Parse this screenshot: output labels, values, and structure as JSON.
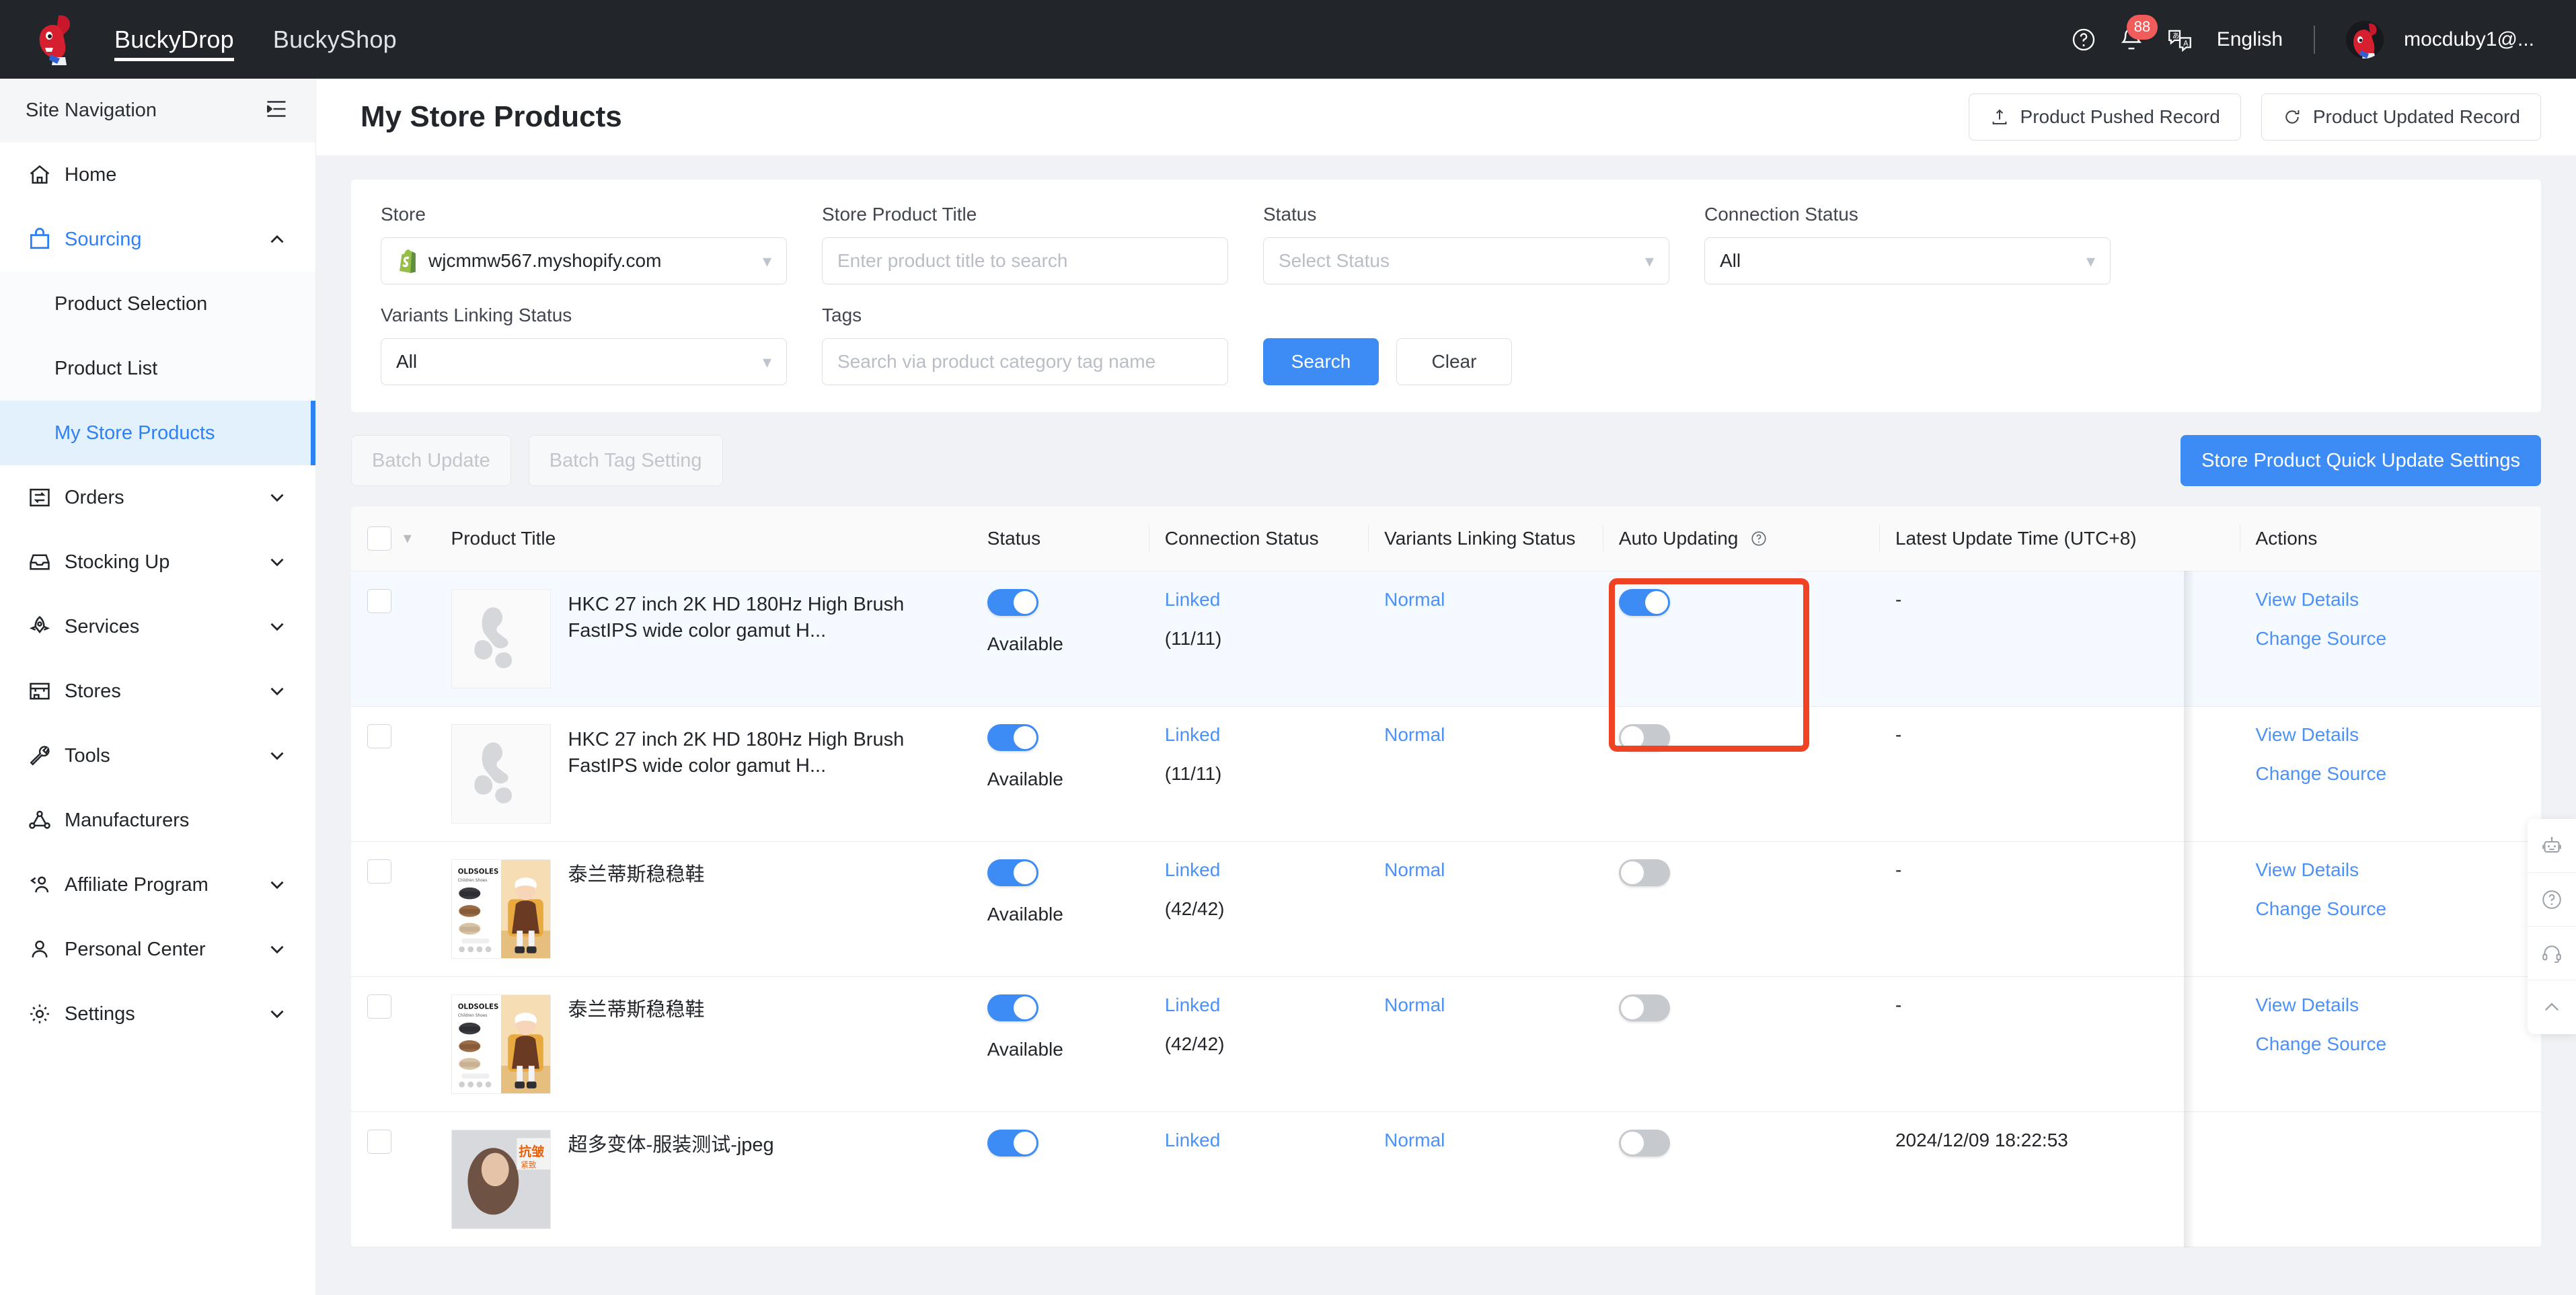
{
  "header": {
    "logo_icon": "bucky-dragon-logo",
    "tabs": [
      {
        "label": "BuckyDrop",
        "active": true
      },
      {
        "label": "BuckyShop",
        "active": false
      }
    ],
    "help_icon": "question-circle-icon",
    "notification_icon": "bell-icon",
    "notification_count": "88",
    "language_icon": "translate-icon",
    "language": "English",
    "avatar_icon": "user-avatar",
    "username": "mocduby1@..."
  },
  "sidebar": {
    "title": "Site Navigation",
    "collapse_icon": "collapse-menu-icon",
    "items": [
      {
        "label": "Home",
        "icon": "home-icon",
        "chevron": false,
        "state": "normal"
      },
      {
        "label": "Sourcing",
        "icon": "shopping-bag-icon",
        "chevron": "up",
        "state": "expanded"
      },
      {
        "label": "Product Selection",
        "sub": true,
        "state": "normal"
      },
      {
        "label": "Product List",
        "sub": true,
        "state": "normal"
      },
      {
        "label": "My Store Products",
        "sub": true,
        "state": "active"
      },
      {
        "label": "Orders",
        "icon": "orders-exchange-icon",
        "chevron": "down",
        "state": "normal"
      },
      {
        "label": "Stocking Up",
        "icon": "inbox-icon",
        "chevron": "down",
        "state": "normal"
      },
      {
        "label": "Services",
        "icon": "rocket-icon",
        "chevron": "down",
        "state": "normal"
      },
      {
        "label": "Stores",
        "icon": "storefront-icon",
        "chevron": "down",
        "state": "normal"
      },
      {
        "label": "Tools",
        "icon": "wrench-icon",
        "chevron": "down",
        "state": "normal"
      },
      {
        "label": "Manufacturers",
        "icon": "network-nodes-icon",
        "chevron": false,
        "state": "normal"
      },
      {
        "label": "Affiliate Program",
        "icon": "users-group-icon",
        "chevron": "down",
        "state": "normal"
      },
      {
        "label": "Personal Center",
        "icon": "user-icon",
        "chevron": "down",
        "state": "normal"
      },
      {
        "label": "Settings",
        "icon": "gear-icon",
        "chevron": "down",
        "state": "normal"
      }
    ]
  },
  "page": {
    "title": "My Store Products",
    "actions": [
      {
        "label": "Product Pushed Record",
        "icon": "upload-icon"
      },
      {
        "label": "Product Updated Record",
        "icon": "refresh-icon"
      }
    ]
  },
  "filters": {
    "store": {
      "label": "Store",
      "value": "wjcmmw567.myshopify.com",
      "icon": "shopify-icon"
    },
    "store_product_title": {
      "label": "Store Product Title",
      "placeholder": "Enter product title to search",
      "value": ""
    },
    "status": {
      "label": "Status",
      "placeholder": "Select Status",
      "value": ""
    },
    "connection_status": {
      "label": "Connection Status",
      "value": "All"
    },
    "variants_linking_status": {
      "label": "Variants Linking Status",
      "value": "All"
    },
    "tags": {
      "label": "Tags",
      "placeholder": "Search via product category tag name",
      "value": ""
    },
    "search_label": "Search",
    "clear_label": "Clear"
  },
  "toolbar": {
    "batch_update": "Batch Update",
    "batch_tag_setting": "Batch Tag Setting",
    "quick_update_settings": "Store Product Quick Update Settings"
  },
  "table": {
    "columns": [
      "Product Title",
      "Status",
      "Connection Status",
      "Variants Linking Status",
      "Auto Updating",
      "Latest Update Time (UTC+8)",
      "Actions"
    ],
    "auto_updating_help_icon": "question-circle-icon",
    "select_all_caret_icon": "chevron-down-icon",
    "rows": [
      {
        "title": "HKC 27 inch 2K HD 180Hz High Brush FastIPS wide color gamut H...",
        "thumb": "monitor-placeholder",
        "status_toggle": "on",
        "status_label": "Available",
        "connection": "Linked",
        "connection_count": "(11/11)",
        "variants_linking": "Normal",
        "auto_updating": "on",
        "latest_update_time": "-",
        "actions": [
          "View Details",
          "Change Source"
        ],
        "highlighted": true
      },
      {
        "title": "HKC 27 inch 2K HD 180Hz High Brush FastIPS wide color gamut H...",
        "thumb": "monitor-placeholder",
        "status_toggle": "on",
        "status_label": "Available",
        "connection": "Linked",
        "connection_count": "(11/11)",
        "variants_linking": "Normal",
        "auto_updating": "off",
        "latest_update_time": "-",
        "actions": [
          "View Details",
          "Change Source"
        ],
        "highlighted": false
      },
      {
        "title": "泰兰蒂斯稳稳鞋",
        "thumb": "oldsoles-shoes",
        "status_toggle": "on",
        "status_label": "Available",
        "connection": "Linked",
        "connection_count": "(42/42)",
        "variants_linking": "Normal",
        "auto_updating": "off",
        "latest_update_time": "-",
        "actions": [
          "View Details",
          "Change Source"
        ],
        "highlighted": false
      },
      {
        "title": "泰兰蒂斯稳稳鞋",
        "thumb": "oldsoles-shoes",
        "status_toggle": "on",
        "status_label": "Available",
        "connection": "Linked",
        "connection_count": "(42/42)",
        "variants_linking": "Normal",
        "auto_updating": "off",
        "latest_update_time": "-",
        "actions": [
          "View Details",
          "Change Source"
        ],
        "highlighted": false
      },
      {
        "title": "超多变体-服装测试-jpeg",
        "thumb": "apparel-model",
        "status_toggle": "on",
        "status_label": "",
        "connection": "Linked",
        "connection_count": "",
        "variants_linking": "Normal",
        "auto_updating": "off",
        "latest_update_time": "2024/12/09 18:22:53",
        "actions": [],
        "highlighted": false
      }
    ]
  },
  "float_tools": [
    {
      "icon": "robot-icon"
    },
    {
      "icon": "question-circle-icon"
    },
    {
      "icon": "headset-support-icon"
    },
    {
      "icon": "chevron-up-icon"
    }
  ],
  "colors": {
    "accent": "#3d8bf5",
    "link": "#4b91f7",
    "annotation": "#f04324",
    "topbar": "#22262b",
    "page_bg": "#f0f2f5"
  }
}
